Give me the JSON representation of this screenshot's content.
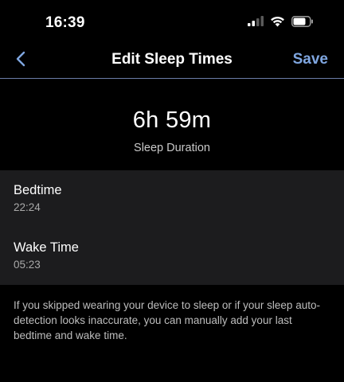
{
  "status_bar": {
    "time": "16:39",
    "icons": [
      "cellular-signal-icon",
      "wifi-icon",
      "battery-icon"
    ]
  },
  "nav": {
    "back_icon": "chevron-left-icon",
    "title": "Edit Sleep Times",
    "save_label": "Save"
  },
  "summary": {
    "duration": "6h 59m",
    "label": "Sleep Duration"
  },
  "times": [
    {
      "label": "Bedtime",
      "value": "22:24"
    },
    {
      "label": "Wake Time",
      "value": "05:23"
    }
  ],
  "help_text": "If you skipped wearing your device to sleep or if your sleep auto-detection looks inaccurate, you can manually add your last bedtime and wake time.",
  "colors": {
    "background": "#000000",
    "panel": "#1c1c1e",
    "accent": "#7fa6e0",
    "divider": "#6a7da8"
  }
}
